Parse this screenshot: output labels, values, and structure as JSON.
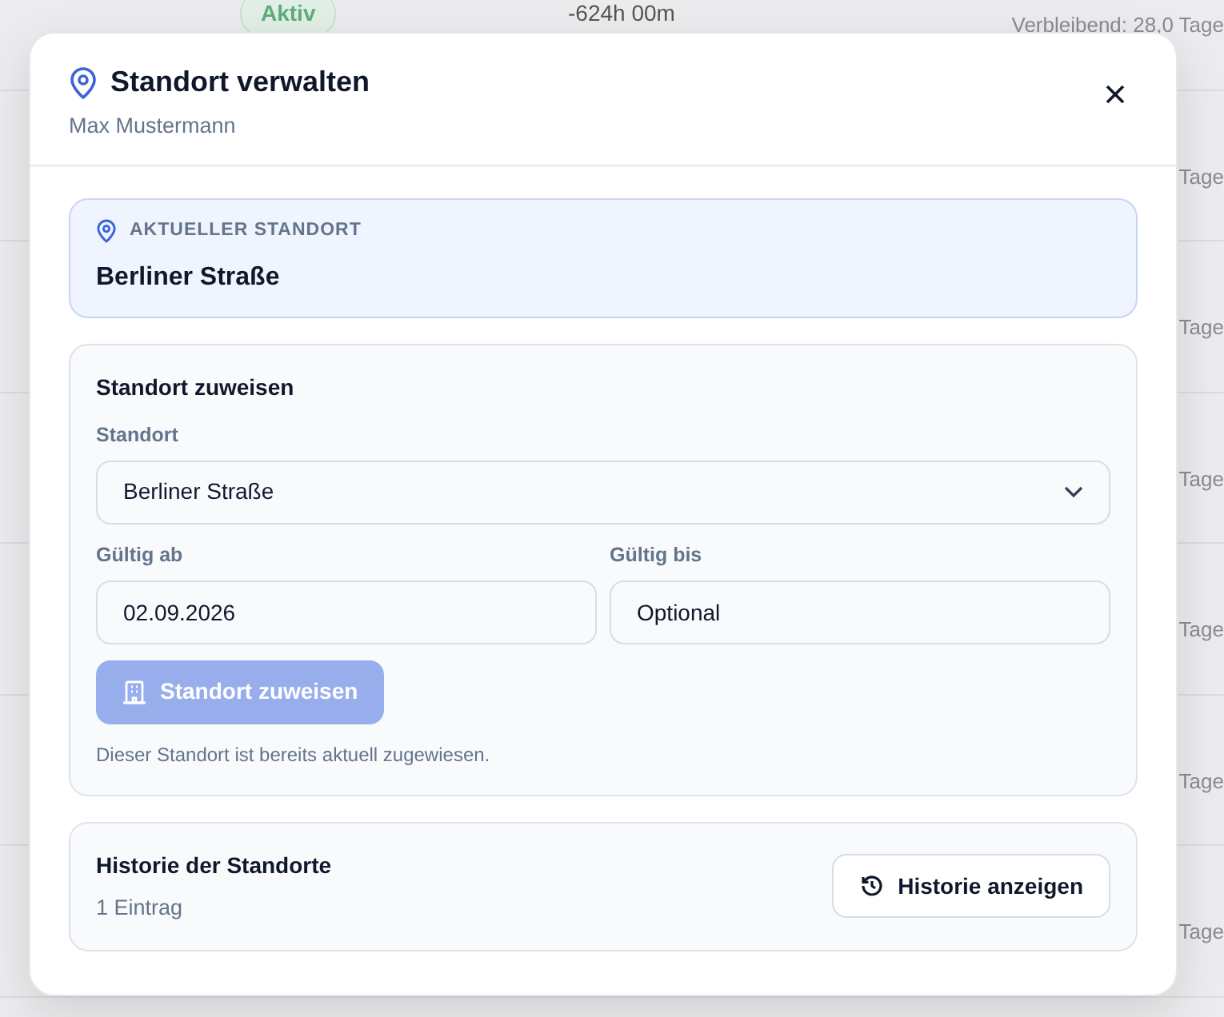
{
  "background_table": {
    "rows": [
      {
        "status": "Aktiv",
        "time": "-624h 00m",
        "remaining": "Verbleibend: 28,0 Tage"
      },
      {
        "remaining": "Tage"
      },
      {
        "remaining": "Tage"
      },
      {
        "remaining": "Tage"
      },
      {
        "remaining": "Tage"
      },
      {
        "remaining": "Tage"
      },
      {
        "remaining": "Tage"
      }
    ]
  },
  "dialog": {
    "title": "Standort verwalten",
    "subtitle": "Max Mustermann",
    "current_location": {
      "label": "AKTUELLER STANDORT",
      "value": "Berliner Straße"
    },
    "assign": {
      "title": "Standort zuweisen",
      "location_label": "Standort",
      "location_value": "Berliner Straße",
      "valid_from_label": "Gültig ab",
      "valid_from_value": "02.09.2026",
      "valid_to_label": "Gültig bis",
      "valid_to_placeholder": "Optional",
      "button": {
        "label": "Standort zuweisen",
        "disabled": true
      },
      "note": "Dieser Standort ist bereits aktuell zugewiesen."
    },
    "history": {
      "title": "Historie der Standorte",
      "count": "1 Eintrag",
      "button": "Historie anzeigen"
    }
  }
}
